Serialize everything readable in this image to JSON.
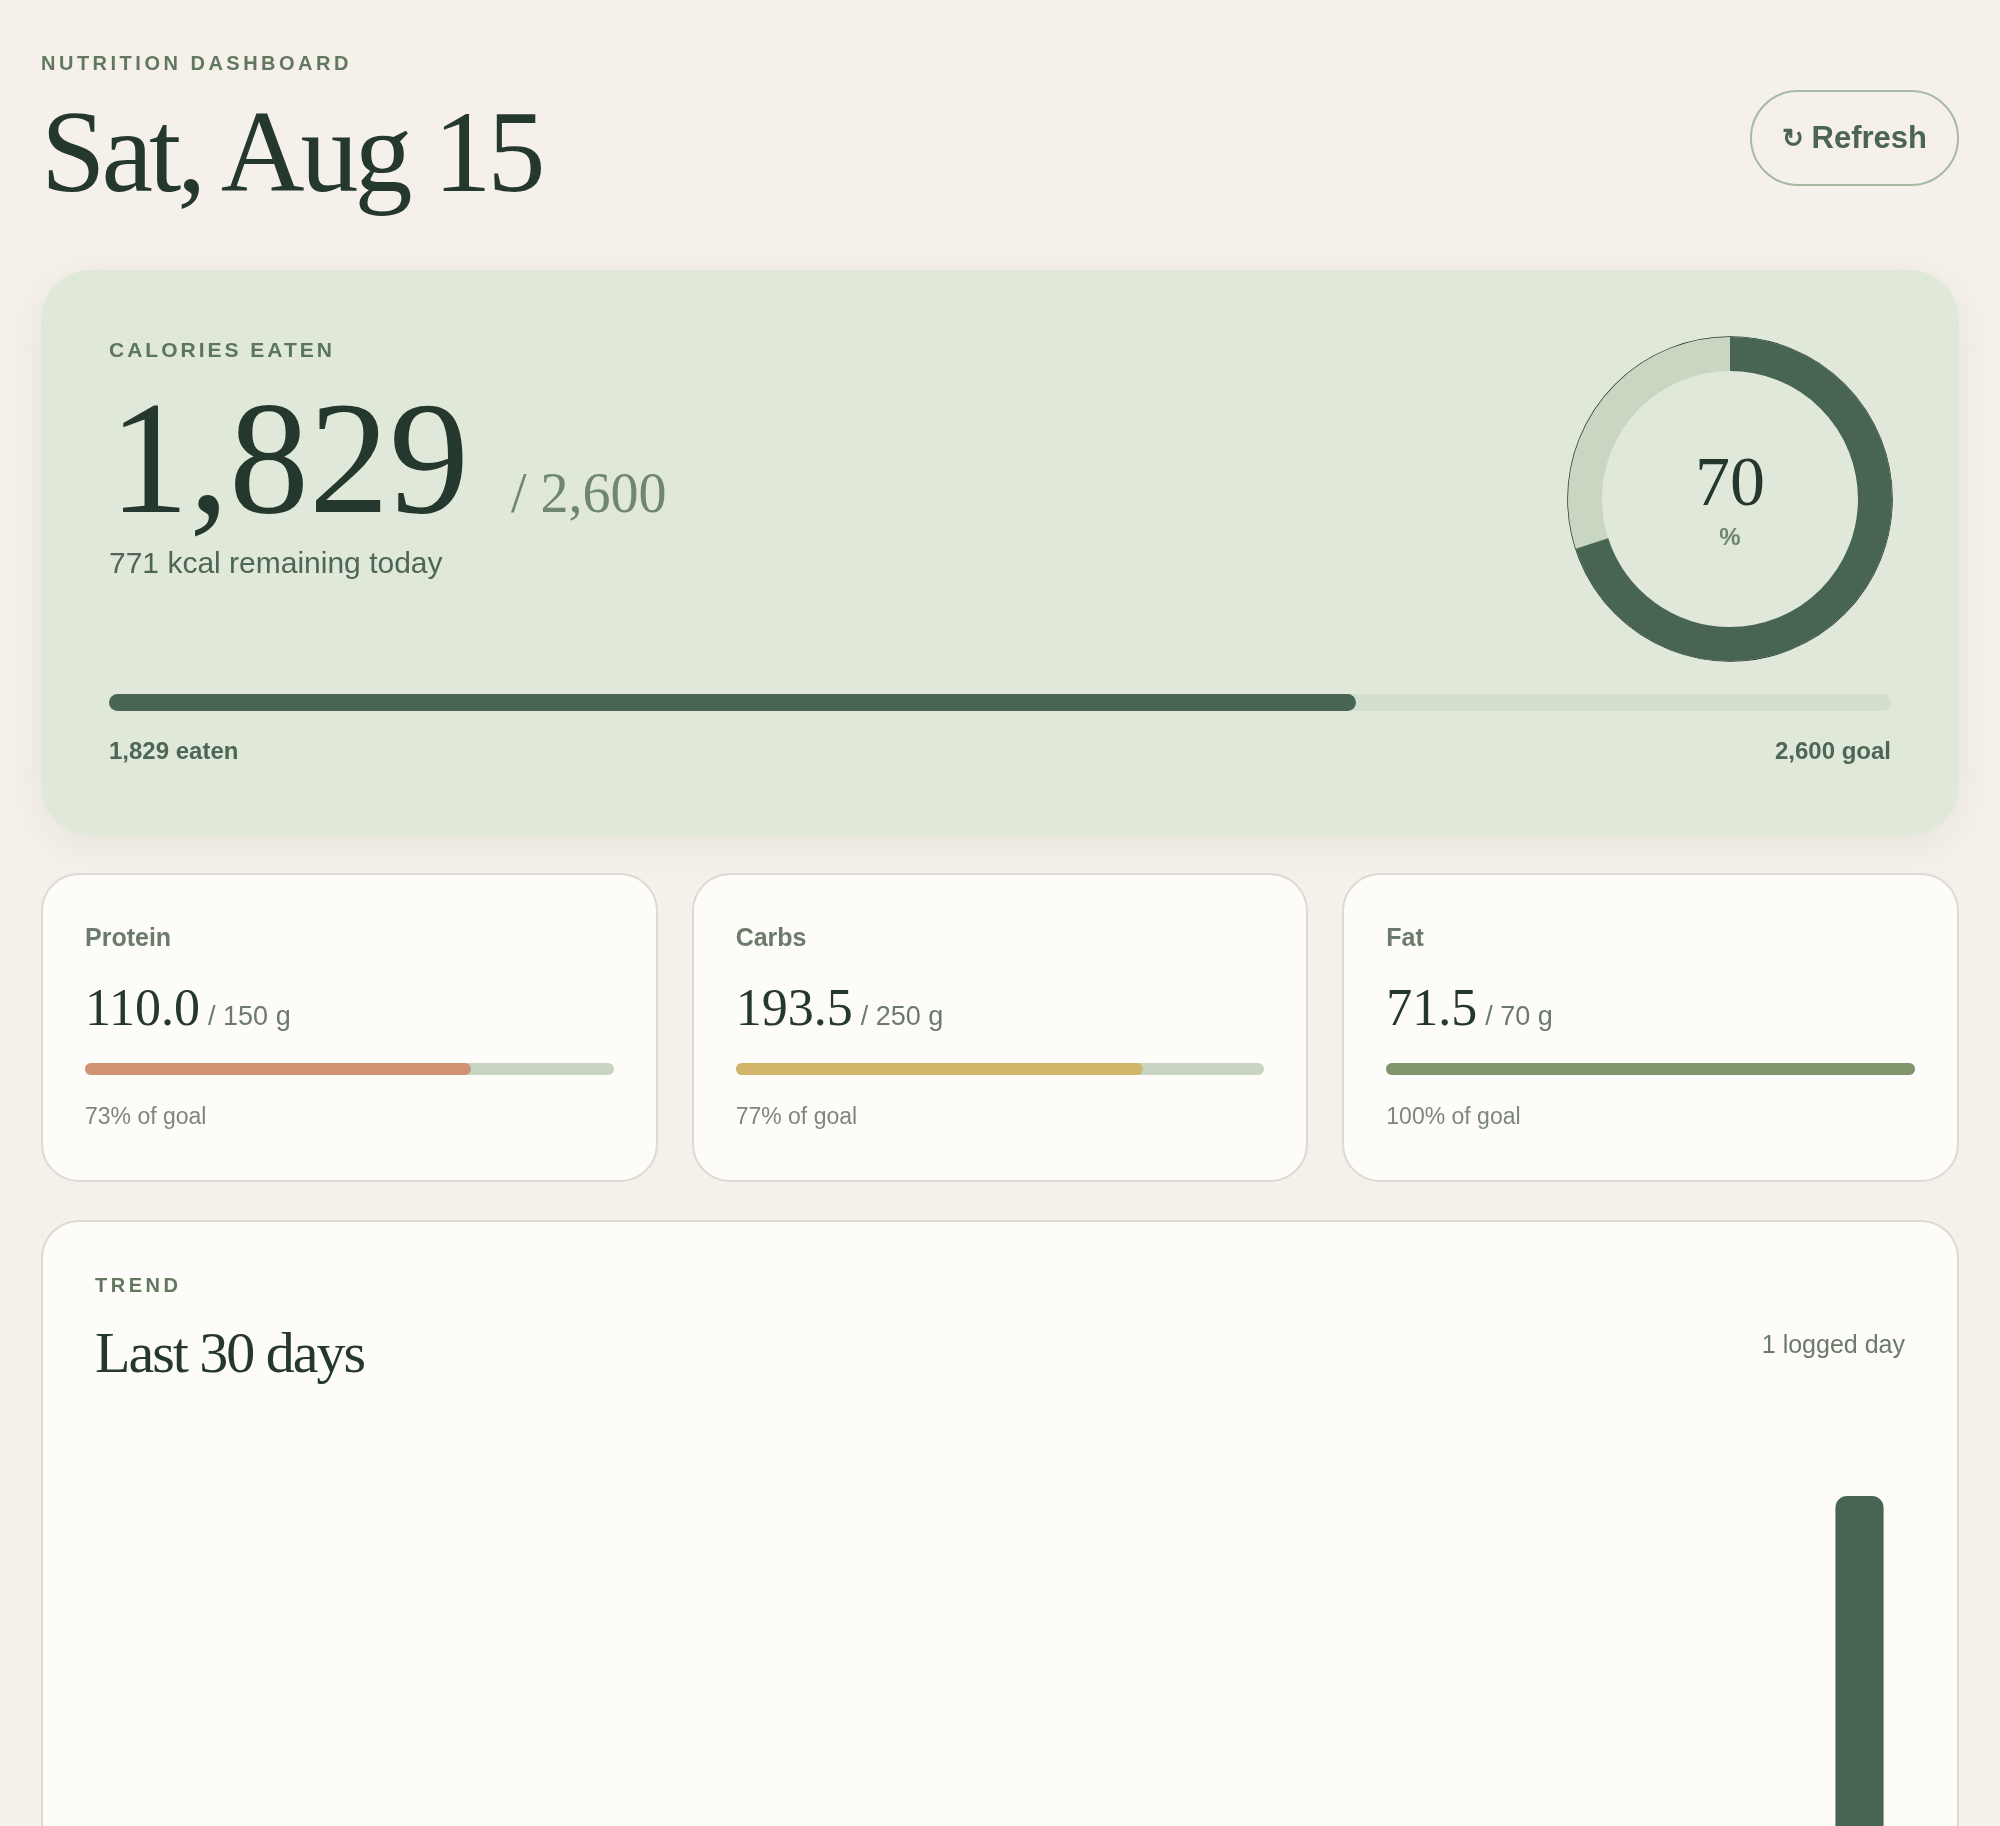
{
  "header": {
    "eyebrow": "NUTRITION DASHBOARD",
    "title": "Sat, Aug 15",
    "refresh_button": {
      "icon": "↻",
      "label": "Refresh"
    }
  },
  "calories": {
    "label": "CALORIES EATEN",
    "eaten": "1,829",
    "goal": "/ 2,600",
    "remaining": "771 kcal remaining today",
    "level": 0.7,
    "eaten_label": "1,829 eaten",
    "goal_label": "2,600 goal",
    "ring": {
      "level": 0.7,
      "value": "70",
      "unit": "%"
    }
  },
  "macros": [
    {
      "name": "Protein",
      "value": "110.0",
      "goal": "/ 150 g",
      "level": 0.73,
      "color": "#cf9273",
      "percent": "73% of goal"
    },
    {
      "name": "Carbs",
      "value": "193.5",
      "goal": "/ 250 g",
      "level": 0.77,
      "color": "#d1b56b",
      "percent": "77% of goal"
    },
    {
      "name": "Fat",
      "value": "71.5",
      "goal": "/ 70 g",
      "level": 1,
      "color": "#82946c",
      "percent": "100% of goal"
    }
  ],
  "trend": {
    "eyebrow": "TREND",
    "title": "Last 30 days",
    "count": "1 logged day"
  }
}
